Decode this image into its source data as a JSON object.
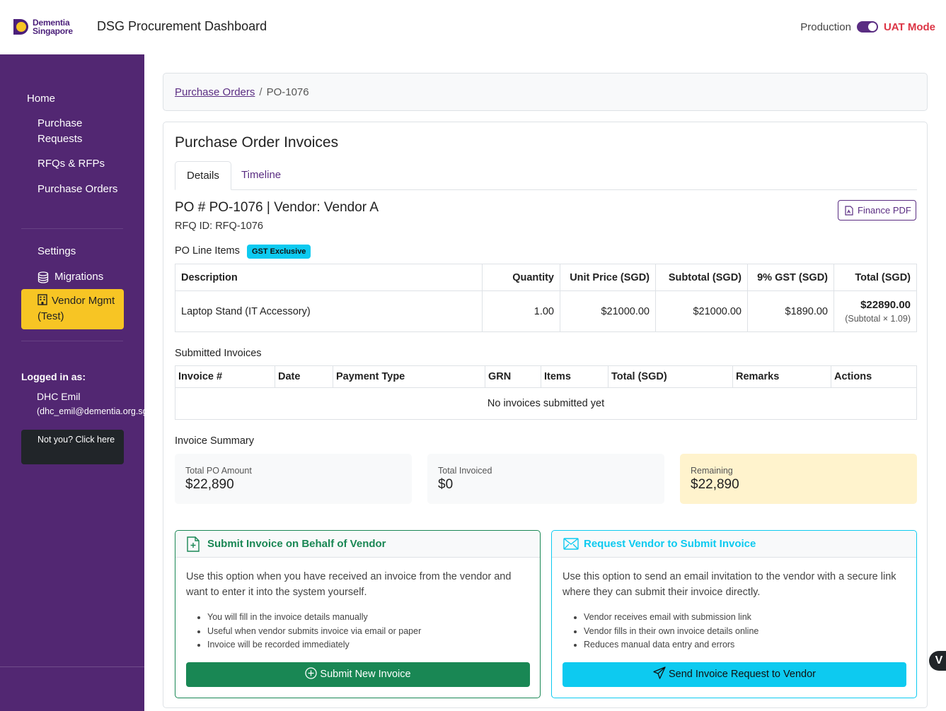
{
  "header": {
    "logo_line1": "Dementia",
    "logo_line2": "Singapore",
    "app_title": "DSG Procurement Dashboard",
    "env_label": "Production",
    "uat_label": "UAT Mode"
  },
  "sidebar": {
    "home": "Home",
    "purchase_requests": "Purchase Requests",
    "rfqs": "RFQs & RFPs",
    "purchase_orders": "Purchase Orders",
    "settings": "Settings",
    "migrations": "Migrations",
    "vendor_mgmt": "Vendor Mgmt (Test)",
    "logged_in_label": "Logged in as:",
    "user_name": "DHC Emil",
    "user_email": "(dhc_emil@dementia.org.sg)",
    "not_you": "Not you? Click here"
  },
  "breadcrumb": {
    "parent": "Purchase Orders",
    "separator": "/",
    "current": "PO-1076"
  },
  "main": {
    "title": "Purchase Order Invoices",
    "tabs": [
      {
        "label": "Details",
        "active": true
      },
      {
        "label": "Timeline",
        "active": false
      }
    ],
    "po_heading": "PO # PO-1076 | Vendor: Vendor A",
    "rfq_id": "RFQ ID: RFQ-1076",
    "finance_pdf": "Finance PDF",
    "line_items_label": "PO Line Items",
    "gst_badge": "GST Exclusive",
    "line_items_headers": [
      "Description",
      "Quantity",
      "Unit Price (SGD)",
      "Subtotal (SGD)",
      "9% GST (SGD)",
      "Total (SGD)"
    ],
    "line_items": [
      {
        "description": "Laptop Stand (IT Accessory)",
        "quantity": "1.00",
        "unit_price": "$21000.00",
        "subtotal": "$21000.00",
        "gst": "$1890.00",
        "total": "$22890.00",
        "total_note": "(Subtotal × 1.09)"
      }
    ],
    "submitted_label": "Submitted Invoices",
    "invoice_headers": [
      "Invoice #",
      "Date",
      "Payment Type",
      "GRN",
      "Items",
      "Total (SGD)",
      "Remarks",
      "Actions"
    ],
    "no_invoices": "No invoices submitted yet",
    "summary_label": "Invoice Summary",
    "summary": [
      {
        "label": "Total PO Amount",
        "value": "$22,890"
      },
      {
        "label": "Total Invoiced",
        "value": "$0"
      },
      {
        "label": "Remaining",
        "value": "$22,890"
      }
    ],
    "option_submit": {
      "title": "Submit Invoice on Behalf of Vendor",
      "description": "Use this option when you have received an invoice from the vendor and want to enter it into the system yourself.",
      "bullets": [
        "You will fill in the invoice details manually",
        "Useful when vendor submits invoice via email or paper",
        "Invoice will be recorded immediately"
      ],
      "button": "Submit New Invoice"
    },
    "option_request": {
      "title": "Request Vendor to Submit Invoice",
      "description": "Use this option to send an email invitation to the vendor with a secure link where they can submit their invoice directly.",
      "bullets": [
        "Vendor receives email with submission link",
        "Vendor fills in their own invoice details online",
        "Reduces manual data entry and errors"
      ],
      "button": "Send Invoice Request to Vendor"
    }
  },
  "colors": {
    "brand_purple": "#522772",
    "accent_yellow": "#f7c524",
    "success_green": "#198754",
    "info_cyan": "#0dcaf0",
    "uat_red": "#dc3545"
  },
  "corner_badge": "V"
}
